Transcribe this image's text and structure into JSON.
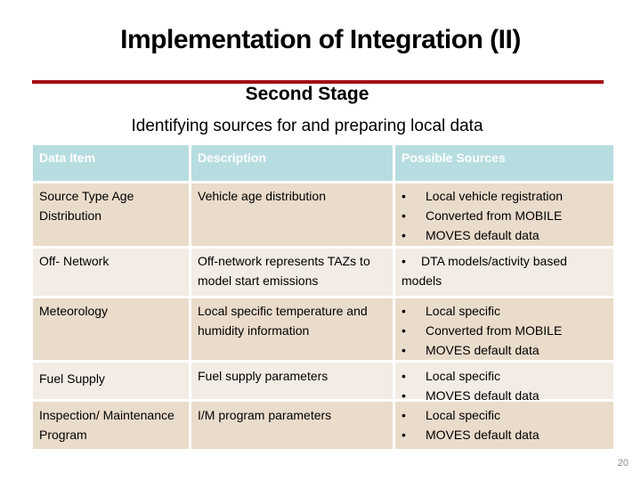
{
  "slide": {
    "title": "Implementation of Integration (II)",
    "subtitle": "Second Stage",
    "lead": "Identifying sources for and preparing local data",
    "page_number": "20",
    "accent_color": "#a50d12"
  },
  "table": {
    "headers": [
      "Data Item",
      "Description",
      "Possible Sources"
    ],
    "rows": [
      {
        "item": "Source Type Age Distribution",
        "description": "Vehicle age distribution",
        "sources": [
          "Local vehicle registration",
          "Converted from MOBILE",
          "MOVES  default data"
        ]
      },
      {
        "item": "Off- Network",
        "description": "Off-network represents TAZs to model start emissions",
        "sources_text": "DTA models/activity based models"
      },
      {
        "item": "Meteorology",
        "description": "Local specific temperature and humidity information",
        "sources": [
          "Local specific",
          "Converted from MOBILE",
          "MOVES  default data"
        ]
      },
      {
        "item": "Fuel Supply",
        "description": "Fuel supply parameters",
        "sources": [
          "Local specific",
          "MOVES  default data"
        ]
      },
      {
        "item": "Inspection/ Maintenance Program",
        "description": "I/M program parameters",
        "sources": [
          "Local specific",
          "MOVES  default data"
        ]
      }
    ],
    "bullet_glyph": "•"
  }
}
